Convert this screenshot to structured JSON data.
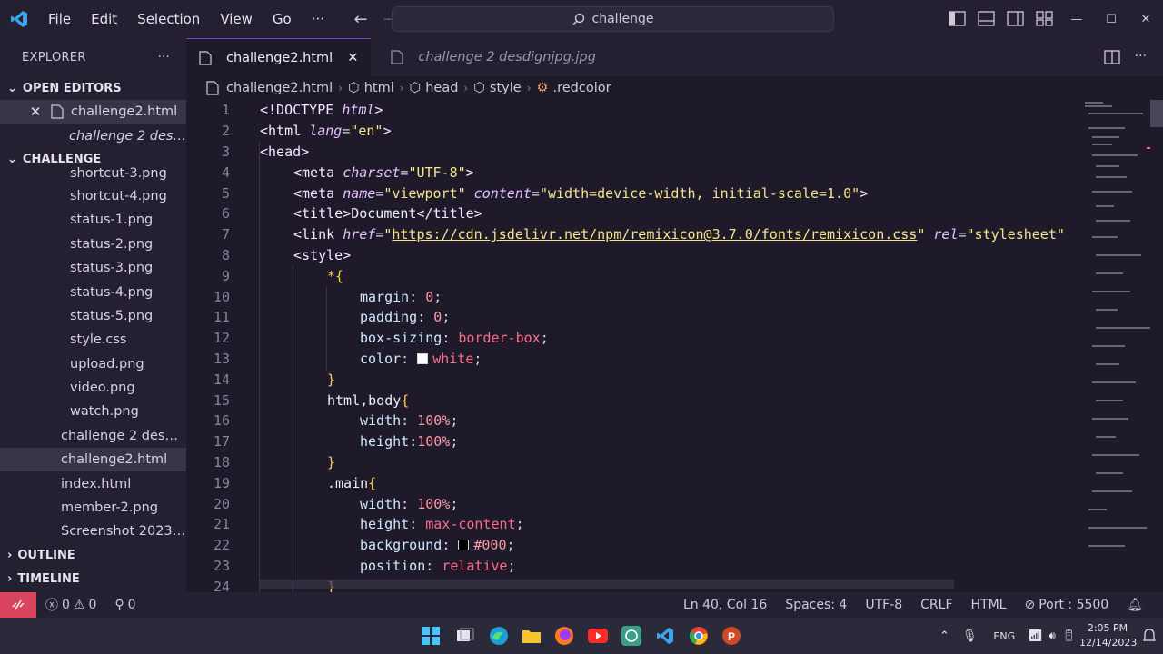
{
  "titlebar": {
    "menu": [
      "File",
      "Edit",
      "Selection",
      "View",
      "Go"
    ],
    "more": "···",
    "search_text": "challenge",
    "controls": {
      "minimize": "—",
      "maximize": "☐",
      "close": "✕"
    }
  },
  "sidebar": {
    "title": "EXPLORER",
    "more": "···",
    "open_editors_label": "OPEN EDITORS",
    "open_editors": [
      "challenge2.html",
      "challenge 2 desd..."
    ],
    "folder_label": "CHALLENGE",
    "files": [
      "shortcut-3.png",
      "shortcut-4.png",
      "status-1.png",
      "status-2.png",
      "status-3.png",
      "status-4.png",
      "status-5.png",
      "style.css",
      "upload.png",
      "video.png",
      "watch.png"
    ],
    "root_files": [
      "challenge 2 desdi...",
      "challenge2.html",
      "index.html",
      "member-2.png",
      "Screenshot 2023-..."
    ],
    "outline_label": "OUTLINE",
    "timeline_label": "TIMELINE"
  },
  "tabs": [
    {
      "label": "challenge2.html",
      "close": "✕"
    },
    {
      "label": "challenge 2 desdignjpg.jpg"
    }
  ],
  "breadcrumbs": [
    "challenge2.html",
    "html",
    "head",
    "style",
    ".redcolor"
  ],
  "code_lines": {
    "n": [
      "1",
      "2",
      "3",
      "4",
      "5",
      "6",
      "7",
      "8",
      "9",
      "10",
      "11",
      "12",
      "13",
      "14",
      "15",
      "16",
      "17",
      "18",
      "19",
      "20",
      "21",
      "22",
      "23",
      "24"
    ]
  },
  "code": {
    "l1": [
      "<!DOCTYPE ",
      "html",
      ">"
    ],
    "l2": [
      "<html ",
      "lang",
      "=",
      "\"en\"",
      ">"
    ],
    "l3": [
      "<head>"
    ],
    "l4": [
      "<meta ",
      "charset",
      "=",
      "\"UTF-8\"",
      ">"
    ],
    "l5": [
      "<meta ",
      "name",
      "=",
      "\"viewport\"",
      " content",
      "=",
      "\"width=device-width, initial-scale=1.0\"",
      ">"
    ],
    "l6": [
      "<title>",
      "Document",
      "</title>"
    ],
    "l7": [
      "<link ",
      "href",
      "=",
      "\"",
      "https://cdn.jsdelivr.net/npm/remixicon@3.7.0/fonts/remixicon.css",
      "\"",
      " rel",
      "=",
      "\"stylesheet\""
    ],
    "l8": [
      "<style>"
    ],
    "l9": [
      "*",
      "{"
    ],
    "l10": [
      "margin",
      ": ",
      "0",
      ";"
    ],
    "l11": [
      "padding",
      ": ",
      "0",
      ";"
    ],
    "l12": [
      "box-sizing",
      ": ",
      "border-box",
      ";"
    ],
    "l13": [
      "color",
      ": ",
      "white",
      ";"
    ],
    "l14": [
      "}"
    ],
    "l15": [
      "html,body",
      "{"
    ],
    "l16": [
      "width",
      ": ",
      "100%",
      ";"
    ],
    "l17": [
      "height",
      ":",
      "100%",
      ";"
    ],
    "l18": [
      "}"
    ],
    "l19": [
      ".main",
      "{"
    ],
    "l20": [
      "width",
      ": ",
      "100%",
      ";"
    ],
    "l21": [
      "height",
      ": ",
      "max-content",
      ";"
    ],
    "l22": [
      "background",
      ": ",
      "#000",
      ";"
    ],
    "l23": [
      "position",
      ": ",
      "relative",
      ";"
    ],
    "l24": [
      "}"
    ]
  },
  "swatches": {
    "white": "#ffffff",
    "black": "#000000"
  },
  "statusbar": {
    "errors": "0",
    "warnings": "0",
    "ports": "0",
    "position": "Ln 40, Col 16",
    "spaces": "Spaces: 4",
    "encoding": "UTF-8",
    "eol": "CRLF",
    "language": "HTML",
    "port": "Port : 5500"
  },
  "taskbar": {
    "lang": "ENG",
    "time": "2:05 PM",
    "date": "12/14/2023"
  },
  "colors": {
    "accent": "#6b4fc4",
    "remote": "#d9455f"
  }
}
